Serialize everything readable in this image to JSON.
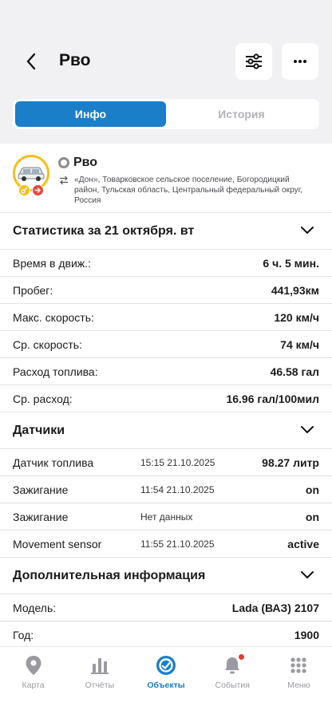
{
  "header": {
    "title": "Рво",
    "back_icon": "chevron-left-icon",
    "filter_icon": "sliders-icon",
    "more_icon": "more-horizontal-icon"
  },
  "tabs": [
    {
      "label": "Инфо",
      "active": true
    },
    {
      "label": "История",
      "active": false
    }
  ],
  "object": {
    "name": "Рво",
    "address": "«Дон», Товарковское сельское поселение, Богородицкий район, Тульская область, Центральный федеральный округ, Россия",
    "status_color": "#8c8c90",
    "ring_color": "#f3c01c"
  },
  "statistics": {
    "title": "Статистика за 21 октября. вт",
    "rows": [
      {
        "label": "Время в движ.:",
        "value": "6 ч. 5 мин."
      },
      {
        "label": "Пробег:",
        "value": "441,93км"
      },
      {
        "label": "Макс. скорость:",
        "value": "120 км/ч"
      },
      {
        "label": "Ср. скорость:",
        "value": "74 км/ч"
      },
      {
        "label": "Расход топлива:",
        "value": "46.58 гал"
      },
      {
        "label": "Ср. расход:",
        "value": "16.96 гал/100мил"
      }
    ]
  },
  "sensors": {
    "title": "Датчики",
    "rows": [
      {
        "label": "Датчик топлива",
        "time": "15:15 21.10.2025",
        "value": "98.27 литр"
      },
      {
        "label": "Зажигание",
        "time": "11:54 21.10.2025",
        "value": "on"
      },
      {
        "label": "Зажигание",
        "time": "Нет данных",
        "value": "on"
      },
      {
        "label": "Movement sensor",
        "time": "11:55 21.10.2025",
        "value": "active"
      }
    ]
  },
  "extra": {
    "title": "Дополнительная информация",
    "rows": [
      {
        "label": "Модель:",
        "value": "Lada (ВАЗ) 2107"
      },
      {
        "label": "Год:",
        "value": "1900"
      }
    ]
  },
  "nav": [
    {
      "label": "Карта",
      "icon": "map-pin-icon",
      "active": false
    },
    {
      "label": "Отчёты",
      "icon": "bar-chart-icon",
      "active": false
    },
    {
      "label": "Объекты",
      "icon": "objects-icon",
      "active": true
    },
    {
      "label": "События",
      "icon": "bell-icon",
      "active": false
    },
    {
      "label": "Меню",
      "icon": "grid-menu-icon",
      "active": false
    }
  ],
  "colors": {
    "accent": "#1a7ec9",
    "background": "#f1f1f3",
    "notification": "#e53935"
  }
}
